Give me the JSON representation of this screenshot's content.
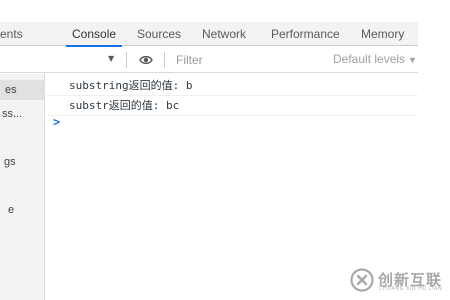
{
  "tabs": [
    {
      "label": "ents"
    },
    {
      "label": "Console"
    },
    {
      "label": "Sources"
    },
    {
      "label": "Network"
    },
    {
      "label": "Performance"
    },
    {
      "label": "Memory"
    }
  ],
  "toolbar": {
    "filter_placeholder": "Filter",
    "levels_label": "Default levels",
    "levels_caret": "▼",
    "context_caret": "▼"
  },
  "sidebar": {
    "items": [
      {
        "label": "es"
      },
      {
        "label": "ss..."
      },
      {
        "label": "gs"
      },
      {
        "label": "e"
      }
    ]
  },
  "console": {
    "messages": [
      {
        "text": "substring返回的值: b"
      },
      {
        "text": "substr返回的值: bc"
      }
    ],
    "prompt_symbol": ">"
  },
  "watermark": {
    "text": "创新互联",
    "subtext": "CHUANG XIN HU LIAN"
  },
  "colors": {
    "accent": "#1a73e8",
    "tabbar_bg": "#f3f3f3",
    "sidebar_bg": "#f3f3f3"
  }
}
